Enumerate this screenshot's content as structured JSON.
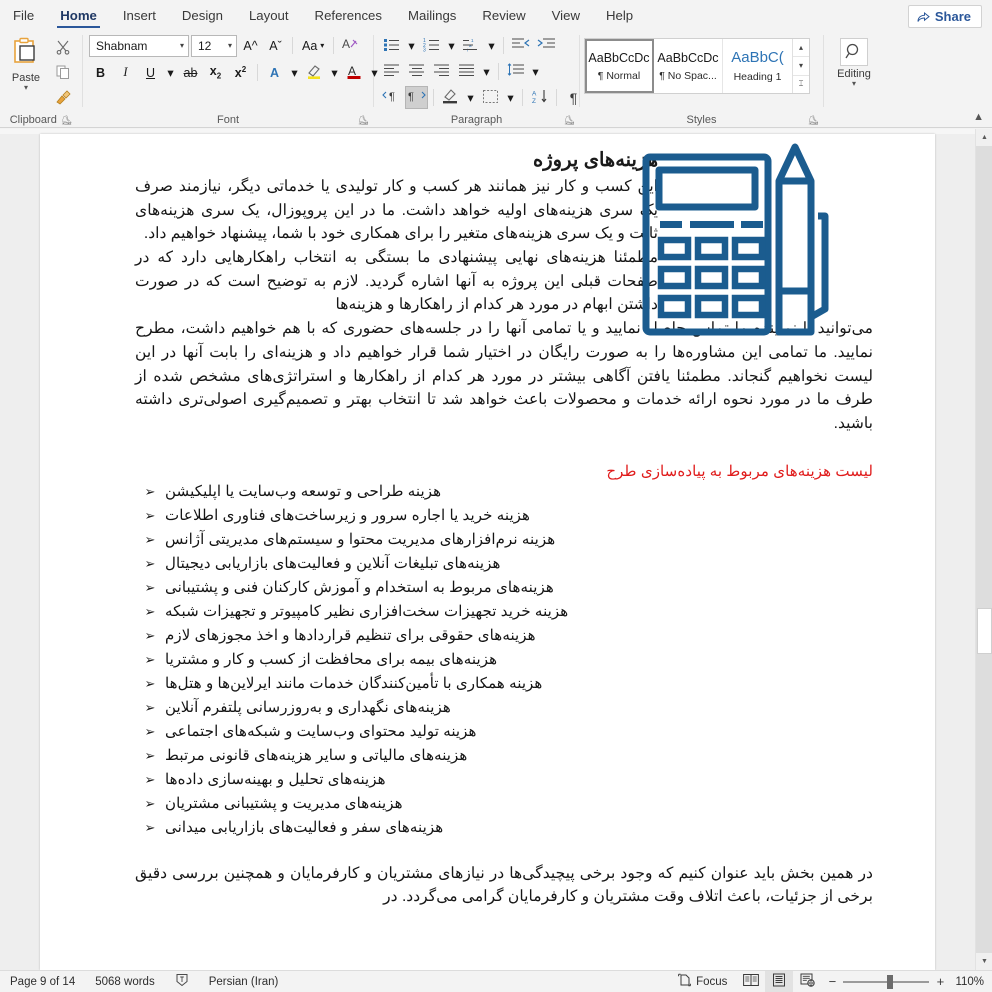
{
  "app": {
    "title": "Microsoft Word"
  },
  "tabs": [
    {
      "label": "File",
      "active": false
    },
    {
      "label": "Home",
      "active": true
    },
    {
      "label": "Insert",
      "active": false
    },
    {
      "label": "Design",
      "active": false
    },
    {
      "label": "Layout",
      "active": false
    },
    {
      "label": "References",
      "active": false
    },
    {
      "label": "Mailings",
      "active": false
    },
    {
      "label": "Review",
      "active": false
    },
    {
      "label": "View",
      "active": false
    },
    {
      "label": "Help",
      "active": false
    }
  ],
  "share": {
    "label": "Share",
    "icon": "share-icon"
  },
  "ribbon": {
    "groups": [
      {
        "name": "Clipboard",
        "label": "Clipboard"
      },
      {
        "name": "Font",
        "label": "Font"
      },
      {
        "name": "Paragraph",
        "label": "Paragraph"
      },
      {
        "name": "Styles",
        "label": "Styles"
      },
      {
        "name": "Editing",
        "label": "Editing"
      }
    ],
    "clipboard": {
      "paste_label": "Paste",
      "cut_icon": "scissors-icon",
      "copy_icon": "copy-icon",
      "format_painter_icon": "format-painter-icon"
    },
    "font": {
      "font_name": "Shabnam",
      "font_size": "12",
      "grow_font": "A^",
      "shrink_font": "Aˇ",
      "change_case": "Aa",
      "clear_formatting": "clear-formatting-icon",
      "bold": "B",
      "italic": "I",
      "underline": "U",
      "strikethrough": "ab",
      "subscript": "x",
      "superscript": "x",
      "text_effects": "A",
      "highlight": "A",
      "font_color": "A"
    },
    "paragraph": {
      "bullets": "bullets-icon",
      "numbering": "numbering-icon",
      "multilevel": "multilevel-list-icon",
      "decrease_indent": "decrease-indent-icon",
      "increase_indent": "increase-indent-icon",
      "align_left": "align-left-icon",
      "align_center": "align-center-icon",
      "align_right": "align-right-icon",
      "justify": "justify-icon",
      "line_spacing": "line-spacing-icon",
      "ltr_text": "ltr-text-direction-icon",
      "rtl_text": "rtl-text-direction-icon",
      "shading": "shading-icon",
      "borders": "borders-icon",
      "sort": "sort-icon",
      "show_marks": "show-paragraph-marks-icon"
    },
    "styles": {
      "items": [
        {
          "preview": "AaBbCcDc",
          "name": "¶ Normal",
          "selected": true,
          "heading": false
        },
        {
          "preview": "AaBbCcDc",
          "name": "¶ No Spac...",
          "selected": false,
          "heading": false
        },
        {
          "preview": "AaBbC(",
          "name": "Heading 1",
          "selected": false,
          "heading": true
        }
      ]
    },
    "editing": {
      "label": "Editing",
      "icon": "magnifier-icon"
    },
    "collapse_icon": "collapse-ribbon-icon"
  },
  "document": {
    "title": "هزینه‌های پروژه",
    "paragraphs": [
      "این کسب و کار نیز همانند هر کسب و کار تولیدی یا خدماتی دیگر، نیازمند صرف یک سری هزینه‌های اولیه خواهد داشت. ما در این پروپوزال، یک سری هزینه‌های ثابت و یک سری هزینه‌های متغیر را برای همکاری خود با شما، پیشنهاد خواهیم داد.",
      "مطمئنا هزینه‌های نهایی پیشنهادی ما بستگی به انتخاب راهکارهایی دارد که در صفحات قبلی این پروژه به آنها اشاره گردید. لازم به توضیح است که در صورت داشتن ابهام در مورد هر کدام از راهکارها و هزینه‌ها",
      "می‌توانید با نماینده ما تماس حاصل نمایید و یا تمامی آنها را در جلسه‌های حضوری که با هم خواهیم داشت، مطرح نمایید. ما تمامی این مشاوره‌ها را به صورت رایگان در اختیار شما قرار خواهیم داد و هزینه‌ای را بابت آنها در این لیست نخواهیم گنجاند. مطمئنا یافتن آگاهی بیشتر در مورد هر کدام از راهکارها و استراتژی‌های مشخص شده از طرف ما در مورد نحوه ارائه خدمات و محصولات باعث خواهد شد تا انتخاب بهتر و تصمیم‌گیری اصولی‌تری داشته باشید."
    ],
    "red_heading": "لیست هزینه‌های مربوط به پیاده‌سازی طرح",
    "red_heading_color": "#e01b1b",
    "bullet_glyph": "➢",
    "bullets": [
      "هزینه طراحی و توسعه وب‌سایت یا اپلیکیشن",
      "هزینه خرید یا اجاره سرور و زیرساخت‌های فناوری اطلاعات",
      "هزینه نرم‌افزارهای مدیریت محتوا و سیستم‌های مدیریتی آژانس",
      "هزینه‌های تبلیغات آنلاین و فعالیت‌های بازاریابی دیجیتال",
      "هزینه‌های مربوط به استخدام و آموزش کارکنان فنی و پشتیبانی",
      "هزینه خرید تجهیزات سخت‌افزاری نظیر کامپیوتر و تجهیزات شبکه",
      "هزینه‌های حقوقی برای تنظیم قراردادها و اخذ مجوزهای لازم",
      "هزینه‌های بیمه برای محافظت از کسب و کار و مشتریا",
      "هزینه همکاری با تأمین‌کنندگان خدمات مانند ایرلاین‌ها و هتل‌ها",
      "هزینه‌های نگهداری و به‌روزرسانی پلتفرم آنلاین",
      "هزینه تولید محتوای وب‌سایت و شبکه‌های اجتماعی",
      "هزینه‌های مالیاتی و سایر هزینه‌های قانونی مرتبط",
      "هزینه‌های تحلیل و بهینه‌سازی داده‌ها",
      "هزینه‌های مدیریت و پشتیبانی مشتریان",
      "هزینه‌های سفر و فعالیت‌های بازاریابی میدانی"
    ],
    "tail_paragraph": "در همین بخش باید عنوان کنیم که وجود برخی پیچیدگی‌ها در نیازهای مشتریان و کارفرمایان و همچنین بررسی دقیق برخی از جزئیات، باعث اتلاف وقت مشتریان و کارفرمایان گرامی می‌گردد. در",
    "artwork": {
      "name": "calculator-and-pencil-illustration",
      "color": "#1b5c8f"
    }
  },
  "statusbar": {
    "page": "Page 9 of 14",
    "words": "5068 words",
    "proofing_icon": "proofing-errors-icon",
    "language": "Persian (Iran)",
    "focus": "Focus",
    "views": [
      {
        "name": "read-mode-view",
        "icon": "book-icon",
        "active": false
      },
      {
        "name": "print-layout-view",
        "icon": "page-icon",
        "active": true
      },
      {
        "name": "web-layout-view",
        "icon": "web-icon",
        "active": false
      }
    ],
    "zoom_out": "−",
    "zoom_in": "+",
    "zoom_level": "110%"
  }
}
